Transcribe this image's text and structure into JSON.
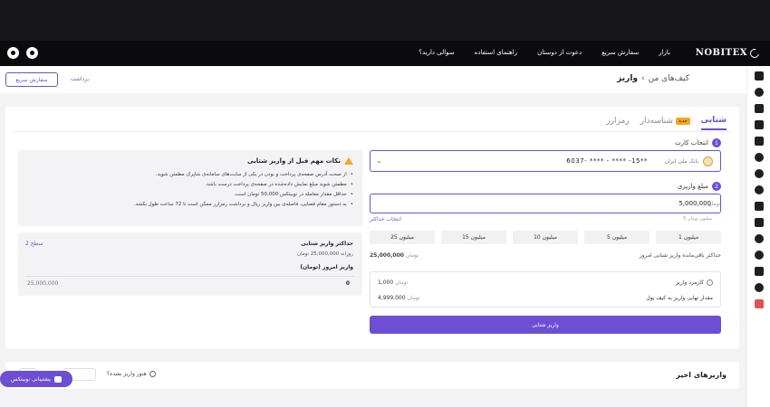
{
  "navbar": {
    "brand": "NOBITEX",
    "links": [
      "بازار",
      "سفارش سریع",
      "دعوت از دوستان",
      "راهنمای استفاده",
      "سوالی دارید؟"
    ]
  },
  "breadcrumb": {
    "parent": "کیف‌های من",
    "current": "واریز"
  },
  "header": {
    "quick_order": "سفارش سریع",
    "withdraw": "برداشت"
  },
  "tabs": [
    {
      "label": "شتابی",
      "active": true
    },
    {
      "label": "شناسه‌دار",
      "badge": "جدید",
      "active": false
    },
    {
      "label": "رمزارز",
      "active": false
    }
  ],
  "form": {
    "step1_num": "1",
    "step1_label": "انتخاب کارت",
    "bank_name": "بانک ملی ایران",
    "card_number": "6037- **** - **** -15**",
    "step2_num": "2",
    "step2_label": "مبلغ واریزی",
    "amount_value": "5,000,000",
    "amount_unit": "تومان",
    "amount_hint": "5 میلیون تومان",
    "max_link": "انتخاب حداکثر",
    "chips": [
      "1 میلیون",
      "5 میلیون",
      "10 میلیون",
      "15 میلیون",
      "25 میلیون"
    ],
    "daily_max_label": "حداکثر باقی‌مانده واریز شتابی امروز",
    "daily_max_value": "25,000,000",
    "daily_max_unit": "تومان",
    "fee_label": "کارمزد واریز",
    "fee_value": "1,000",
    "fee_unit": "تومان",
    "final_label": "مقدار نهایی واریز به کیف پول",
    "final_value": "4,999,000",
    "final_unit": "تومان",
    "submit": "واریز شتابی"
  },
  "notes": {
    "title": "نکات مهم قبل از واریز شتابی",
    "items": [
      "از صحت آدرس صفحه‌ی پرداخت و بودن در یکی از سایت‌های سامانه‌ی شاپرک مطمئن شوید.",
      "مطمئن شوید مبلغ نمایش داده‌شده در صفحه‌ی پرداخت درست باشد.",
      "حداقل مقدار معامله در نوبیتکس 50,000 تومان است.",
      "به دستور مقام قضایی، فاصله‌ی بین واریز ریال و برداشت رمزارز ممکن است تا 72 ساعت طول بکشد."
    ]
  },
  "level": {
    "max_label": "حداکثر واریز شتابی",
    "daily": "روزانه 25,000,000 تومان",
    "today_label": "واریز امروز (تومان)",
    "level_link": "سطح 2",
    "used": "0",
    "limit": "25,000,000"
  },
  "recent": {
    "title": "واریزهای اخیر",
    "not_deposited": "هنوز واریز نشده؟"
  },
  "support": {
    "label": "پشتیبانی نوبیتکس"
  }
}
